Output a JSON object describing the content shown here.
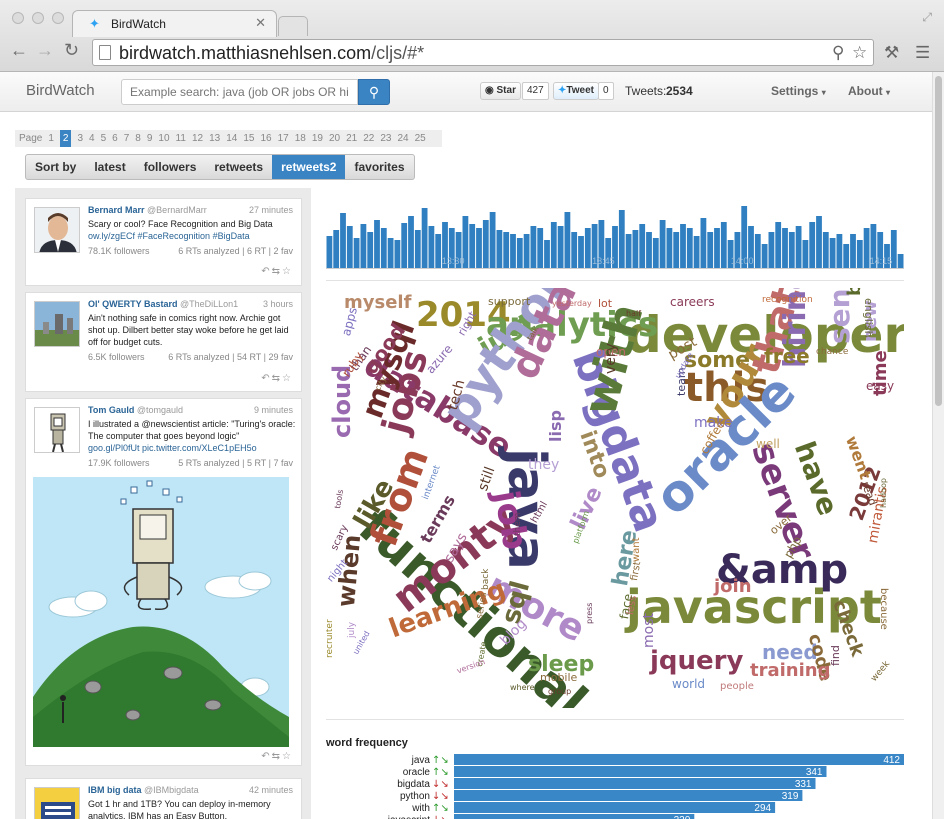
{
  "browser": {
    "tab_title": "BirdWatch",
    "url_host": "birdwatch.matthiasnehlsen.com",
    "url_path": "/cljs/#*"
  },
  "nav": {
    "brand": "BirdWatch",
    "search_placeholder": "Example search: java (job OR jobs OR hiring)",
    "star_label": "Star",
    "star_count": "427",
    "tweet_label": "Tweet",
    "tweet_count": "0",
    "tweets_label": "Tweets:",
    "tweets_count": "2534",
    "settings_label": "Settings",
    "about_label": "About"
  },
  "pagination": {
    "label": "Page",
    "pages": [
      "1",
      "2",
      "3",
      "4",
      "5",
      "6",
      "7",
      "8",
      "9",
      "10",
      "11",
      "12",
      "13",
      "14",
      "15",
      "16",
      "17",
      "18",
      "19",
      "20",
      "21",
      "22",
      "23",
      "24",
      "25"
    ],
    "active": "2"
  },
  "sort": {
    "label": "Sort by",
    "options": [
      "latest",
      "followers",
      "retweets",
      "retweets2",
      "favorites"
    ],
    "active": "retweets2"
  },
  "tweets": [
    {
      "name": "Bernard Marr",
      "handle": "@BernardMarr",
      "time": "27 minutes",
      "text": "Scary or cool? Face Recognition and Big Data",
      "link": "ow.ly/zgECf #FaceRecognition #BigData",
      "followers": "78.1K followers",
      "stats": "6 RTs analyzed | 6 RT | 2 fav"
    },
    {
      "name": "Ol' QWERTY Bastard",
      "handle": "@TheDiLLon1",
      "time": "3 hours",
      "text": "Ain't nothing safe in comics right now. Archie got shot up. Dilbert better stay woke before he get laid off for budget cuts.",
      "link": "",
      "followers": "6.5K followers",
      "stats": "6 RTs analyzed | 54 RT | 29 fav"
    },
    {
      "name": "Tom Gauld",
      "handle": "@tomgauld",
      "time": "9 minutes",
      "text": "I illustrated a @newscientist article: \"Turing's oracle: The computer that goes beyond logic\"",
      "link": "goo.gl/Pl0fUt pic.twitter.com/XLeC1pEH5o",
      "followers": "17.9K followers",
      "stats": "5 RTs analyzed | 5 RT | 7 fav"
    },
    {
      "name": "IBM big data",
      "handle": "@IBMbigdata",
      "time": "42 minutes",
      "text": "Got 1 hr and 1TB? You can deploy in-memory analytics. IBM has an Easy Button.",
      "link": "",
      "followers": "",
      "stats": ""
    }
  ],
  "timeline": {
    "tick_labels": [
      "13:30",
      "13:45",
      "14:00",
      "14:15"
    ],
    "values": [
      32,
      38,
      55,
      42,
      30,
      44,
      36,
      48,
      40,
      30,
      28,
      45,
      52,
      38,
      60,
      42,
      34,
      46,
      40,
      36,
      52,
      44,
      40,
      48,
      56,
      38,
      36,
      34,
      30,
      34,
      42,
      40,
      28,
      46,
      42,
      56,
      36,
      32,
      40,
      44,
      48,
      30,
      42,
      58,
      34,
      38,
      44,
      36,
      30,
      48,
      40,
      36,
      44,
      40,
      32,
      50,
      36,
      40,
      46,
      28,
      36,
      62,
      42,
      34,
      24,
      36,
      46,
      40,
      36,
      42,
      28,
      46,
      52,
      36,
      30,
      34,
      24,
      34,
      28,
      40,
      44,
      36,
      24,
      38,
      14
    ]
  },
  "word_frequency": {
    "title": "word frequency",
    "max": 412,
    "rows": [
      {
        "word": "java",
        "value": 412,
        "arrows": "↑↘"
      },
      {
        "word": "oracle",
        "value": 341,
        "arrows": "↑↘"
      },
      {
        "word": "bigdata",
        "value": 331,
        "arrows": "↓↘"
      },
      {
        "word": "python",
        "value": 319,
        "arrows": "↓↘"
      },
      {
        "word": "with",
        "value": 294,
        "arrows": "↑↘"
      },
      {
        "word": "javascript",
        "value": 220,
        "arrows": "↓↘"
      }
    ]
  },
  "wordcloud": [
    {
      "t": "developer",
      "s": 50,
      "c": "#7a8a3a"
    },
    {
      "t": "2014",
      "s": 34,
      "c": "#9a8a2a"
    },
    {
      "t": "myself",
      "s": 18,
      "c": "#b88a6a"
    },
    {
      "t": "analytics",
      "s": 34,
      "c": "#6f9d52"
    },
    {
      "t": "database",
      "s": 32,
      "c": "#8a3a68"
    },
    {
      "t": "just",
      "s": 28,
      "c": "#6f9d52"
    },
    {
      "t": "python",
      "s": 48,
      "c": "#9fa0cd"
    },
    {
      "t": "data",
      "s": 40,
      "c": "#b06d9a"
    },
    {
      "t": "bigdata",
      "s": 44,
      "c": "#7c70c0"
    },
    {
      "t": "java",
      "s": 52,
      "c": "#3a3a6a"
    },
    {
      "t": "with",
      "s": 46,
      "c": "#5a7a3a"
    },
    {
      "t": "this",
      "s": 40,
      "c": "#8a5a28"
    },
    {
      "t": "some",
      "s": 22,
      "c": "#8a7a2a"
    },
    {
      "t": "your",
      "s": 36,
      "c": "#b08a3a"
    },
    {
      "t": "that",
      "s": 38,
      "c": "#c06a6a"
    },
    {
      "t": "hiring",
      "s": 30,
      "c": "#8a6ab0"
    },
    {
      "t": "senior",
      "s": 28,
      "c": "#b5a0d4"
    },
    {
      "t": "server",
      "s": 34,
      "c": "#7a3a7a"
    },
    {
      "t": "oracle",
      "s": 50,
      "c": "#6a8ac8"
    },
    {
      "t": "functional",
      "s": 50,
      "c": "#3a5a2a"
    },
    {
      "t": "jobs",
      "s": 36,
      "c": "#8a3a58"
    },
    {
      "t": "mysql",
      "s": 30,
      "c": "#6a2a2a"
    },
    {
      "t": "from",
      "s": 38,
      "c": "#b0503a"
    },
    {
      "t": "monty",
      "s": 40,
      "c": "#8a3a58"
    },
    {
      "t": "more",
      "s": 36,
      "c": "#b08ac8"
    },
    {
      "t": "javascript",
      "s": 46,
      "c": "#7a8a3a"
    },
    {
      "t": "&amp",
      "s": 40,
      "c": "#3a2a5a"
    },
    {
      "t": "job",
      "s": 34,
      "c": "#9a3a8a"
    },
    {
      "t": "like",
      "s": 26,
      "c": "#5a5a2a"
    },
    {
      "t": "cloud",
      "s": 24,
      "c": "#9a6ab0"
    },
    {
      "t": "learning",
      "s": 26,
      "c": "#c06a3a"
    },
    {
      "t": "sql",
      "s": 26,
      "c": "#6a6a3a"
    },
    {
      "t": "sleep",
      "s": 22,
      "c": "#6a9a4a"
    },
    {
      "t": "jquery",
      "s": 26,
      "c": "#8a3a58"
    },
    {
      "t": "need",
      "s": 20,
      "c": "#8a9ad0"
    },
    {
      "t": "code",
      "s": 18,
      "c": "#8a6a3a"
    },
    {
      "t": "training",
      "s": 18,
      "c": "#c06a6a"
    },
    {
      "t": "check",
      "s": 18,
      "c": "#7a6a3a"
    },
    {
      "t": "have",
      "s": 28,
      "c": "#5a6a2a"
    },
    {
      "t": "2012",
      "s": 20,
      "c": "#7a3a3a"
    },
    {
      "t": "mirantis",
      "s": 14,
      "c": "#c05a3a"
    },
    {
      "t": "when",
      "s": 24,
      "c": "#5a3a2a"
    },
    {
      "t": "good",
      "s": 20,
      "c": "#8a3a58"
    },
    {
      "t": "free",
      "s": 20,
      "c": "#8a7a2a"
    },
    {
      "t": "into",
      "s": 22,
      "c": "#a08a5a"
    },
    {
      "t": "live",
      "s": 22,
      "c": "#b08ac8"
    },
    {
      "t": "lisp",
      "s": 16,
      "c": "#8a6ab0"
    },
    {
      "t": "here",
      "s": 22,
      "c": "#6a9aa0"
    },
    {
      "t": "join",
      "s": 18,
      "c": "#c06a6a"
    },
    {
      "t": "best",
      "s": 18,
      "c": "#5a6a2a"
    },
    {
      "t": "new",
      "s": 18,
      "c": "#b5a0d4"
    },
    {
      "t": "time",
      "s": 18,
      "c": "#8a3a58"
    },
    {
      "t": "went",
      "s": 16,
      "c": "#b07a3a"
    },
    {
      "t": "tech",
      "s": 14,
      "c": "#6a3a2a"
    },
    {
      "t": "make",
      "s": 14,
      "c": "#7c70c0"
    },
    {
      "t": "well",
      "s": 12,
      "c": "#c0a060"
    },
    {
      "t": "world",
      "s": 12,
      "c": "#6a8ac8"
    },
    {
      "t": "people",
      "s": 10,
      "c": "#c07a7a"
    },
    {
      "t": "most",
      "s": 14,
      "c": "#8a6ab0"
    },
    {
      "t": "face",
      "s": 12,
      "c": "#5a6a2a"
    },
    {
      "t": "blog",
      "s": 14,
      "c": "#b08ac8"
    },
    {
      "t": "mobile",
      "s": 11,
      "c": "#8a6a3a"
    },
    {
      "t": "terms",
      "s": 16,
      "c": "#6a3a5a"
    },
    {
      "t": "says",
      "s": 14,
      "c": "#b06d9a"
    },
    {
      "t": "still",
      "s": 14,
      "c": "#5a3a2a"
    },
    {
      "t": "they",
      "s": 14,
      "c": "#b5a0d4"
    },
    {
      "t": "support",
      "s": 11,
      "c": "#7a6a3a"
    },
    {
      "t": "careers",
      "s": 12,
      "c": "#8a3a58"
    },
    {
      "t": "lot",
      "s": 11,
      "c": "#b0503a"
    },
    {
      "t": "recognition",
      "s": 9,
      "c": "#c06a3a"
    },
    {
      "t": "english",
      "s": 11,
      "c": "#6a6a3a"
    },
    {
      "t": "apps",
      "s": 12,
      "c": "#7c70c0"
    },
    {
      "t": "right",
      "s": 11,
      "c": "#8a6ab0"
    },
    {
      "t": "open",
      "s": 12,
      "c": "#c06a6a"
    },
    {
      "t": "post",
      "s": 14,
      "c": "#8a6a3a"
    },
    {
      "t": "easy",
      "s": 12,
      "c": "#8a3a58"
    },
    {
      "t": "than",
      "s": 12,
      "c": "#6a3a5a"
    },
    {
      "t": "ruby",
      "s": 12,
      "c": "#b0503a"
    },
    {
      "t": "azure",
      "s": 12,
      "c": "#8a6ab0"
    },
    {
      "t": "very",
      "s": 14,
      "c": "#5a3a2a"
    },
    {
      "t": "coffee",
      "s": 12,
      "c": "#b07a3a"
    },
    {
      "t": "team",
      "s": 11,
      "c": "#3a3a6a"
    },
    {
      "t": "php",
      "s": 12,
      "c": "#7a6a3a"
    },
    {
      "t": "over",
      "s": 11,
      "c": "#8a6a3a"
    },
    {
      "t": "read",
      "s": 11,
      "c": "#6a3a2a"
    },
    {
      "t": "because",
      "s": 10,
      "c": "#8a6a3a"
    },
    {
      "t": "chance",
      "s": 9,
      "c": "#8a6a3a"
    },
    {
      "t": "week",
      "s": 9,
      "c": "#7a6a3a"
    },
    {
      "t": "find",
      "s": 11,
      "c": "#6a3a5a"
    },
    {
      "t": "recruiter",
      "s": 9,
      "c": "#9a8a2a"
    },
    {
      "t": "night",
      "s": 10,
      "c": "#7c70c0"
    },
    {
      "t": "scary",
      "s": 10,
      "c": "#6a3a5a"
    },
    {
      "t": "html",
      "s": 10,
      "c": "#6a3a5a"
    },
    {
      "t": "them",
      "s": 9,
      "c": "#6a3a5a"
    },
    {
      "t": "less",
      "s": 10,
      "c": "#c06a6a"
    },
    {
      "t": "first",
      "s": 10,
      "c": "#8a6a3a"
    },
    {
      "t": "want",
      "s": 10,
      "c": "#b07a3a"
    },
    {
      "t": "series",
      "s": 9,
      "c": "#8a6a3a"
    },
    {
      "t": "where",
      "s": 8,
      "c": "#5a5a2a"
    },
    {
      "t": "group",
      "s": 8,
      "c": "#6a3a2a"
    },
    {
      "t": "create",
      "s": 8,
      "c": "#5a6a2a"
    },
    {
      "t": "back",
      "s": 9,
      "c": "#7a6a3a"
    },
    {
      "t": "internet",
      "s": 9,
      "c": "#6a8ac8"
    },
    {
      "t": "update",
      "s": 8,
      "c": "#7c70c0"
    },
    {
      "t": "yesterday",
      "s": 8,
      "c": "#c06a6a"
    },
    {
      "t": "talk",
      "s": 8,
      "c": "#7a6a3a"
    },
    {
      "t": "city",
      "s": 8,
      "c": "#8a6a3a"
    },
    {
      "t": "tools",
      "s": 8,
      "c": "#6a3a5a"
    },
    {
      "t": "july",
      "s": 9,
      "c": "#b08ac8"
    },
    {
      "t": "platform",
      "s": 8,
      "c": "#6a9a4a"
    },
    {
      "t": "press",
      "s": 8,
      "c": "#6a3a5a"
    },
    {
      "t": "version",
      "s": 8,
      "c": "#b06d9a"
    },
    {
      "t": "united",
      "s": 8,
      "c": "#7c70c0"
    },
    {
      "t": "hadoop",
      "s": 8,
      "c": "#6a6a3a"
    },
    {
      "t": "half",
      "s": 8,
      "c": "#6a3a2a"
    }
  ]
}
